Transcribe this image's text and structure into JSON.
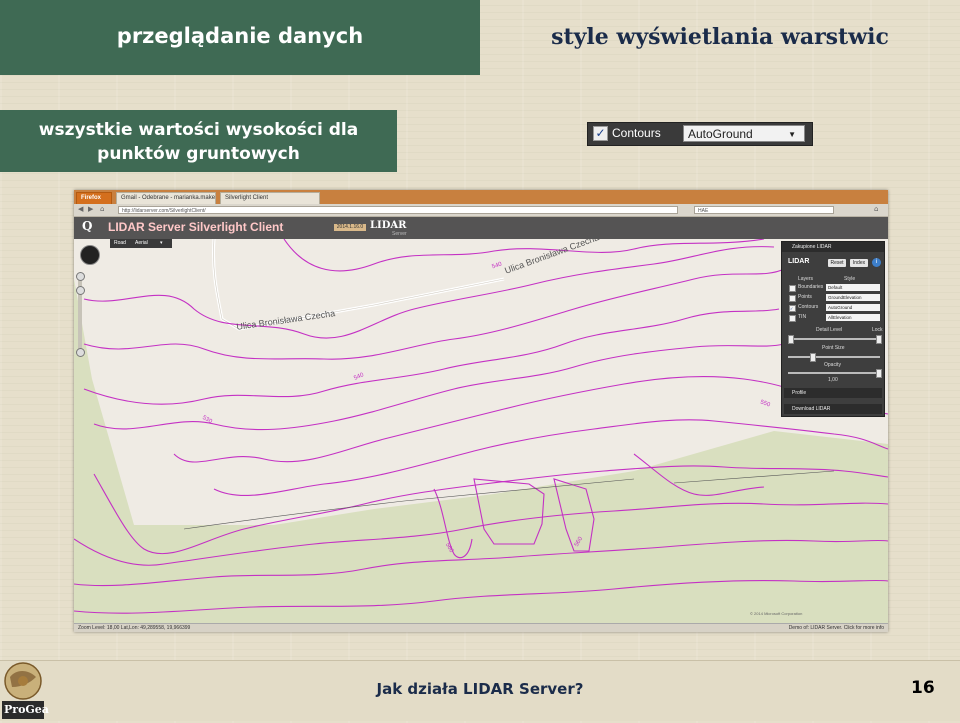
{
  "slide": {
    "header_left": "przeglądanie danych",
    "header_right": "style wyświetlania warstwic",
    "note_line1": "wszystkie wartości wysokości dla",
    "note_line2": "punktów gruntowych",
    "footer_title": "Jak działa LIDAR Server?",
    "page_number": "16",
    "logo_text": "ProGea",
    "colors": {
      "header_green": "#3f6a54",
      "title_navy": "#1b2c4a",
      "contour_magenta": "#c431c4"
    }
  },
  "contours_widget": {
    "checked": true,
    "label": "Contours",
    "selected": "AutoGround"
  },
  "browser": {
    "firefox_tab": "Firefox",
    "tabs": [
      "Gmail - Odebrane - marianka.makes...",
      "Silverlight Client"
    ],
    "url": "http://lidarserver.com/SilverlightClient/",
    "search": "HAE"
  },
  "app": {
    "logo": "Q",
    "title": "LIDAR Server Silverlight Client",
    "version": "2014.1.16.0",
    "brand": "LIDAR",
    "brand_sub": "Server",
    "map_tabs": [
      "Road",
      "Aerial"
    ],
    "road_labels": [
      "Ulica Bronisława Czecha",
      "Ulica Bronisława Czecha"
    ],
    "contour_labels": [
      "540",
      "540",
      "530",
      "560",
      "560",
      "550"
    ]
  },
  "panel": {
    "title": "Zakupione LIDAR",
    "brand": "LIDAR",
    "reset": "Reset",
    "index": "Index",
    "info": "i",
    "col_layers": "Layers",
    "col_style": "Style",
    "layers": [
      {
        "name": "Boundaries",
        "checked": false,
        "style": "Default"
      },
      {
        "name": "Points",
        "checked": false,
        "style": "GroundElevation"
      },
      {
        "name": "Contours",
        "checked": true,
        "style": "AutoGround"
      },
      {
        "name": "TIN",
        "checked": false,
        "style": "AllElevation"
      }
    ],
    "detail_level": "Detail Level",
    "lock": "Lock",
    "point_size": "Point Size",
    "opacity": "Opacity",
    "opacity_value": "1,00",
    "profile": "Profile",
    "download": "Download LIDAR"
  },
  "status": {
    "left": "Zoom Level: 18,00    Lat,Lon: 49,289558,  19,966399",
    "right": "Demo of:  LIDAR Server. Click for more info"
  },
  "copyright": "© 2014 Microsoft Corporation"
}
